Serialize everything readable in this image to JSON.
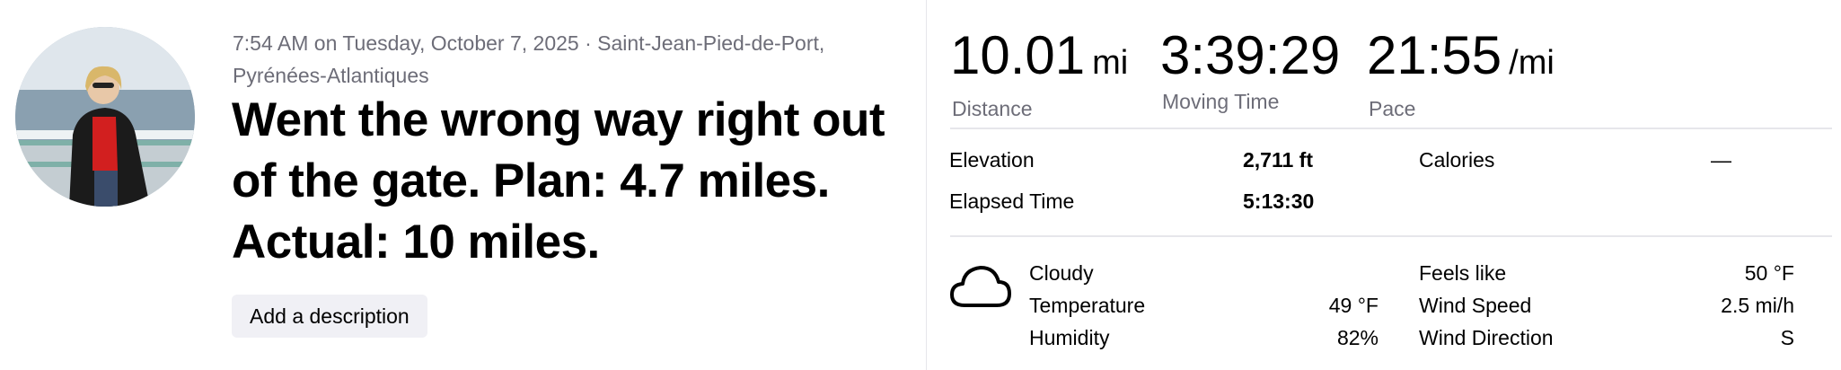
{
  "activity": {
    "meta_line1": "7:54 AM on Tuesday, October 7, 2025 · Saint-Jean-Pied-de-Port,",
    "meta_line2": "Pyrénées-Atlantiques",
    "title_line1": "Went the wrong way right out",
    "title_line2": "of the gate. Plan: 4.7 miles.",
    "title_line3": "Actual: 10 miles.",
    "add_description_label": "Add a description"
  },
  "stats": {
    "distance": {
      "value": "10.01",
      "unit": "mi",
      "label": "Distance"
    },
    "moving_time": {
      "value": "3:39:29",
      "label": "Moving Time"
    },
    "pace": {
      "value": "21:55",
      "unit": "/mi",
      "label": "Pace"
    }
  },
  "details": {
    "elevation_label": "Elevation",
    "elevation_value": "2,711 ft",
    "calories_label": "Calories",
    "calories_value": "—",
    "elapsed_label": "Elapsed Time",
    "elapsed_value": "5:13:30"
  },
  "weather": {
    "icon": "cloud-icon",
    "condition": "Cloudy",
    "temperature_label": "Temperature",
    "temperature_value": "49 °F",
    "humidity_label": "Humidity",
    "humidity_value": "82%",
    "feels_like_label": "Feels like",
    "feels_like_value": "50 °F",
    "wind_speed_label": "Wind Speed",
    "wind_speed_value": "2.5 mi/h",
    "wind_direction_label": "Wind Direction",
    "wind_direction_value": "S"
  },
  "colors": {
    "muted": "#6d6d78",
    "divider": "#e6e6eb",
    "button_bg": "#f0f0f5"
  }
}
